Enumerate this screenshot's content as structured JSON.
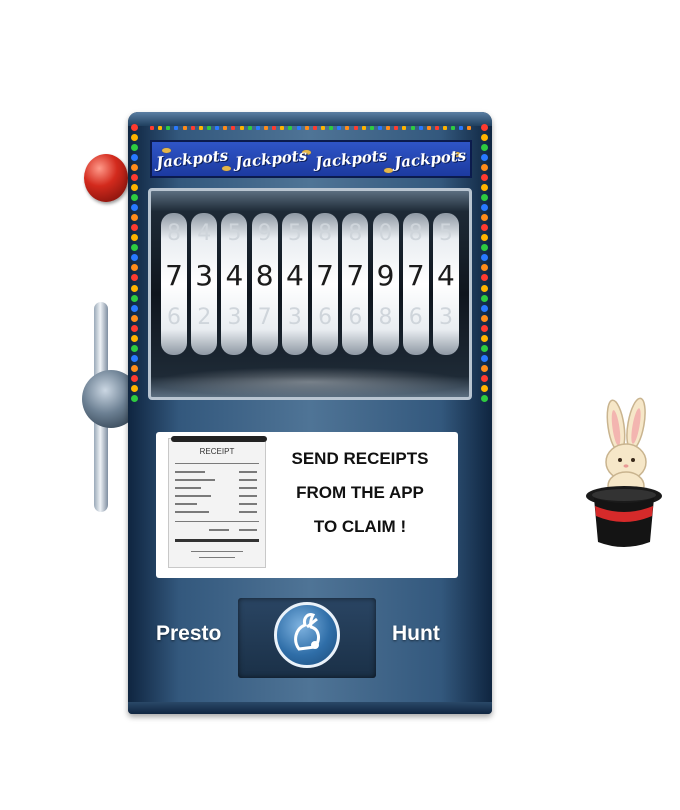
{
  "banner": {
    "words": [
      "Jackpots",
      "Jackpots",
      "Jackpots",
      "Jackpots"
    ]
  },
  "reels": [
    {
      "above": "8",
      "main": "7",
      "below": "6"
    },
    {
      "above": "4",
      "main": "3",
      "below": "2"
    },
    {
      "above": "5",
      "main": "4",
      "below": "3"
    },
    {
      "above": "9",
      "main": "8",
      "below": "7"
    },
    {
      "above": "5",
      "main": "4",
      "below": "3"
    },
    {
      "above": "8",
      "main": "7",
      "below": "6"
    },
    {
      "above": "8",
      "main": "7",
      "below": "6"
    },
    {
      "above": "0",
      "main": "9",
      "below": "8"
    },
    {
      "above": "8",
      "main": "7",
      "below": "6"
    },
    {
      "above": "5",
      "main": "4",
      "below": "3"
    }
  ],
  "panel": {
    "receipt_title": "RECEIPT",
    "line1": "SEND RECEIPTS",
    "line2": "FROM THE APP",
    "line3": "TO CLAIM !"
  },
  "brand": {
    "left": "Presto",
    "right": "Hunt"
  },
  "colors": {
    "cabinet": "#3e6488",
    "banner": "#2a4fc0",
    "lever_knob": "#d32a1d",
    "bulbs": [
      "#ff3b2f",
      "#ffb400",
      "#2ecc40",
      "#2979ff",
      "#ff8c1a"
    ]
  },
  "icons": {
    "logo": "rabbit-circle-logo",
    "mascot": "rabbit-in-hat-icon"
  }
}
